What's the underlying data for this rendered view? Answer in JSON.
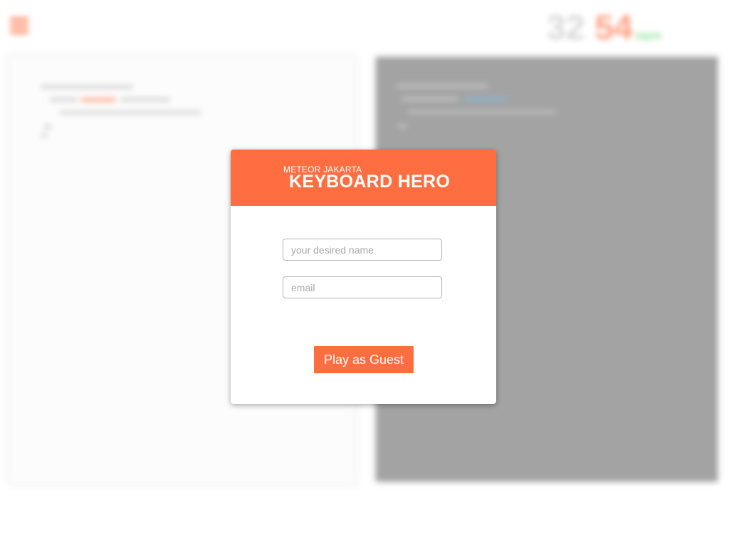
{
  "header": {
    "menu_icon": "hamburger-menu-icon",
    "score": {
      "primary": "32",
      "secondary": "54",
      "unit": "wpm"
    }
  },
  "footer": {
    "text": "",
    "link": ""
  },
  "modal": {
    "subtitle": "METEOR JAKARTA",
    "title": "KEYBOARD HERO",
    "name_placeholder": "your desired name",
    "name_value": "",
    "email_placeholder": "email",
    "email_value": "",
    "play_button_label": "Play as Guest"
  },
  "colors": {
    "accent": "#ff6e40",
    "score_primary": "#d8d8d8",
    "score_secondary": "#ff9f82",
    "score_unit": "#8fe39a",
    "right_panel": "#a3a3a3"
  }
}
